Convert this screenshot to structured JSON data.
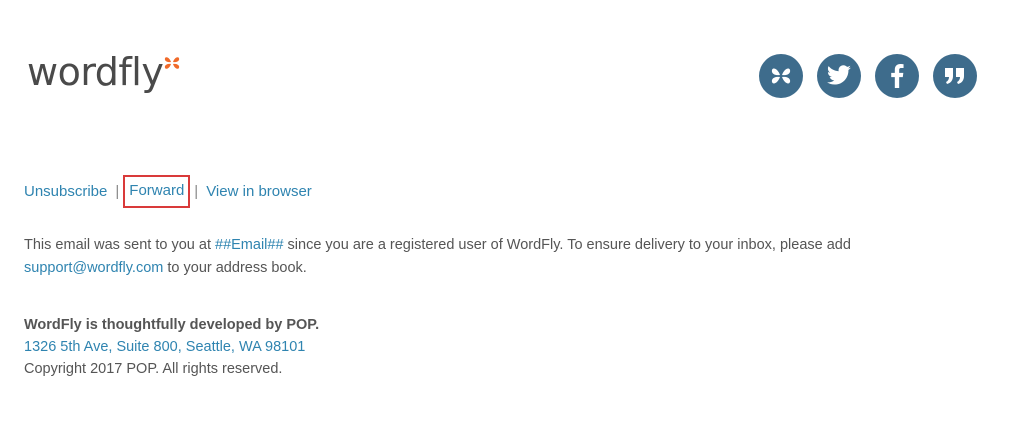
{
  "brand": {
    "name": "wordfly",
    "accent_color": "#f06a2a",
    "icon_color": "#3e6c8c",
    "link_color": "#2f84b0"
  },
  "social": [
    {
      "name": "wordfly-icon"
    },
    {
      "name": "twitter-icon"
    },
    {
      "name": "facebook-icon"
    },
    {
      "name": "quote-icon"
    }
  ],
  "links": {
    "unsubscribe": "Unsubscribe",
    "separator": "|",
    "forward": "Forward",
    "view_in_browser": "View in browser"
  },
  "notice": {
    "prefix": "This email was sent to you at ",
    "email_token": "##Email##",
    "middle": " since you are a registered user of WordFly. To ensure delivery to your inbox, please add",
    "support_email": "support@wordfly.com",
    "suffix": " to your address book."
  },
  "footer": {
    "developer": "WordFly is thoughtfully developed by POP.",
    "address": "1326 5th Ave, Suite 800, Seattle, WA 98101",
    "copyright": "Copyright 2017 POP. All rights reserved."
  }
}
